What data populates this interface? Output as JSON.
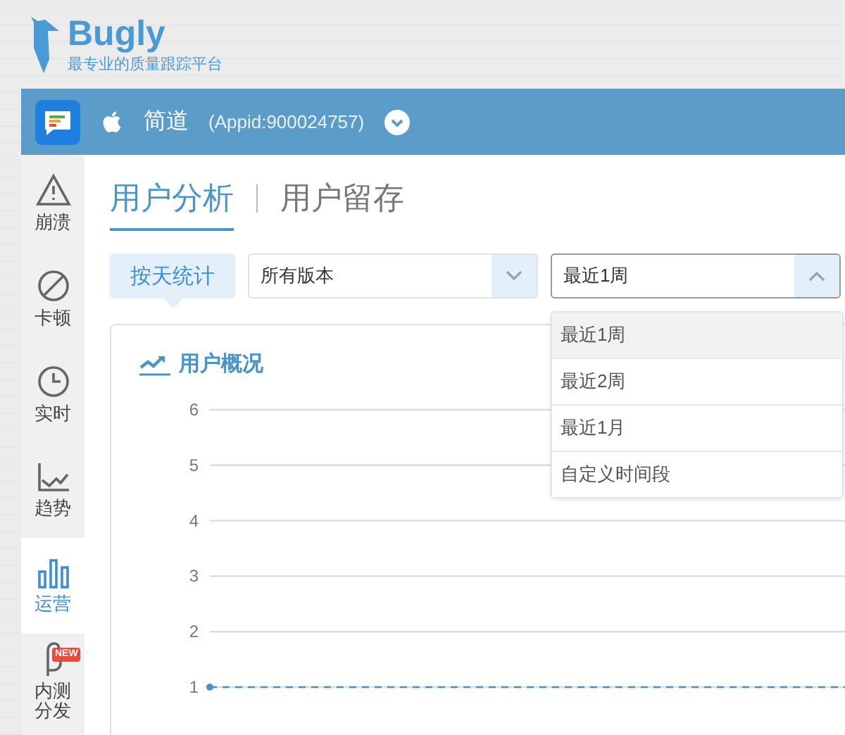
{
  "brand": {
    "name": "Bugly",
    "tagline": "最专业的质量跟踪平台"
  },
  "app_bar": {
    "name": "简道",
    "appid": "(Appid:900024757)"
  },
  "sidebar": {
    "items": [
      {
        "kind": "crash",
        "label": "崩溃",
        "selected": false
      },
      {
        "kind": "lag",
        "label": "卡顿",
        "selected": false
      },
      {
        "kind": "realtime",
        "label": "实时",
        "selected": false
      },
      {
        "kind": "trend",
        "label": "趋势",
        "selected": false
      },
      {
        "kind": "ops",
        "label": "运营",
        "selected": true
      },
      {
        "kind": "beta",
        "label": "内测分发",
        "selected": false,
        "badge": "NEW"
      }
    ]
  },
  "page_tabs": [
    {
      "label": "用户分析",
      "selected": true
    },
    {
      "label": "用户留存",
      "selected": false
    }
  ],
  "filters": {
    "mode": "按天统计",
    "version": "所有版本",
    "period": "最近1周",
    "period_expanded": true
  },
  "period_options": [
    {
      "label": "最近1周",
      "selected": true
    },
    {
      "label": "最近2周",
      "selected": false
    },
    {
      "label": "最近1月",
      "selected": false
    },
    {
      "label": "自定义时间段",
      "selected": false
    }
  ],
  "card": {
    "title": "用户概况",
    "chart_data": {
      "type": "line",
      "yticks": [
        1,
        2,
        3,
        4,
        5,
        6
      ],
      "ylim": [
        1,
        6
      ],
      "grid": true,
      "series": [
        {
          "color": "#4a90c4",
          "line_style": "dashed",
          "values": [
            1,
            1,
            1,
            1,
            1,
            1,
            1
          ]
        }
      ]
    }
  }
}
